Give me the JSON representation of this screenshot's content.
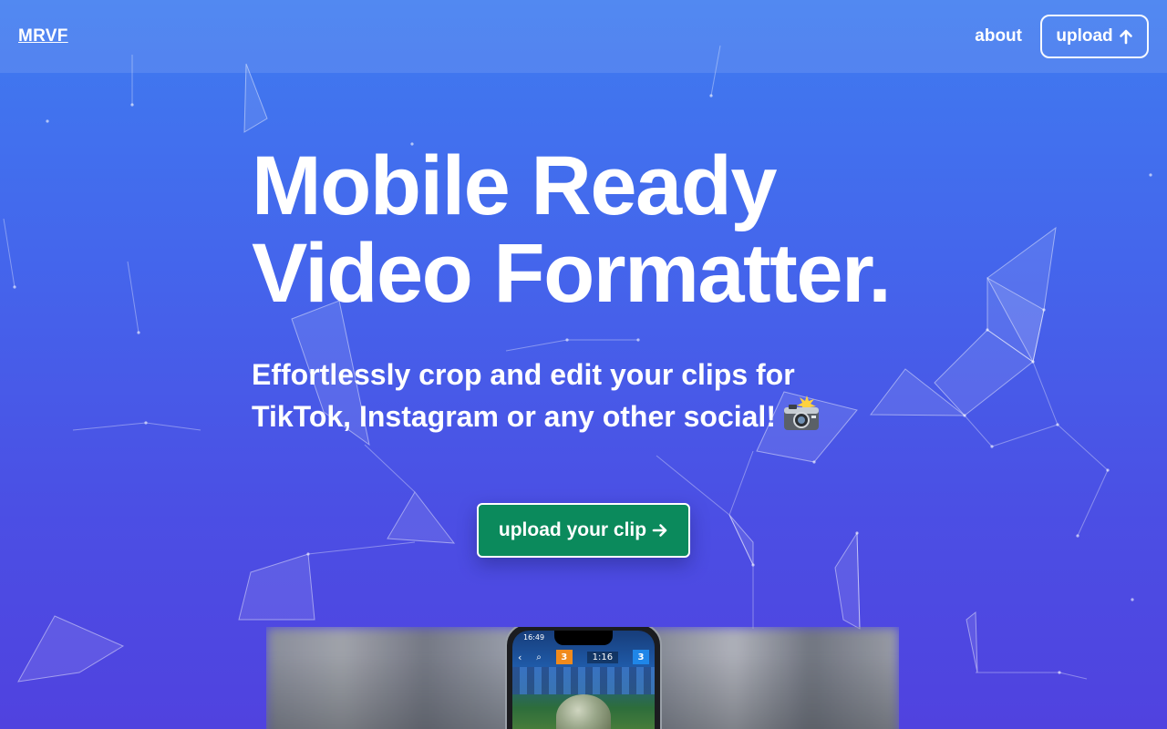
{
  "navbar": {
    "logo": "MRVF",
    "about_label": "about",
    "upload_label": "upload",
    "upload_icon": "arrow-up-icon"
  },
  "hero": {
    "title_line1": "Mobile Ready",
    "title_line2": "Video Formatter.",
    "subtitle_line1": "Effortlessly crop and edit your clips for",
    "subtitle_line2": "TikTok, Instagram or any other social!",
    "subtitle_emoji": "camera-with-flash-icon",
    "cta_label": "upload your clip",
    "cta_icon": "arrow-right-icon"
  },
  "preview": {
    "phone_time": "16:49",
    "score_left": "3",
    "score_right": "3",
    "timer": "1:16"
  },
  "colors": {
    "background_top": "#3f7cf0",
    "background_bottom": "#5042df",
    "cta_green": "#0b8a5c",
    "text": "#ffffff"
  }
}
